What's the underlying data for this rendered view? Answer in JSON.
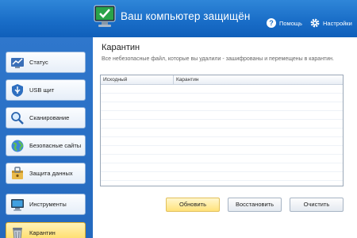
{
  "header": {
    "title": "Ваш компьютер защищён",
    "help_label": "Помощь",
    "settings_label": "Настройки",
    "logo_icon": "monitor-check-icon"
  },
  "sidebar": {
    "items": [
      {
        "label": "Статус",
        "icon": "status-icon",
        "active": false
      },
      {
        "label": "USB щит",
        "icon": "usb-shield-icon",
        "active": false
      },
      {
        "label": "Сканирование",
        "icon": "scan-magnifier-icon",
        "active": false
      },
      {
        "label": "Безопасные сайты",
        "icon": "globe-icon",
        "active": false
      },
      {
        "label": "Защита данных",
        "icon": "data-protection-icon",
        "active": false
      },
      {
        "label": "Инструменты",
        "icon": "tools-monitor-icon",
        "active": false
      },
      {
        "label": "Карантин",
        "icon": "trash-bin-icon",
        "active": true
      }
    ]
  },
  "main": {
    "title": "Карантин",
    "description": "Все небезопасные файл, которые вы удалили - зашифрованы и перемещены в карантин.",
    "table": {
      "columns": [
        "Исходный",
        "Карантин"
      ],
      "rows": []
    },
    "buttons": {
      "refresh": "Обновить",
      "restore": "Восстановить",
      "clear": "Очистить"
    }
  },
  "colors": {
    "header_blue": "#1a6ec8",
    "sidebar_blue": "#2a70c5",
    "active_yellow": "#ffd95c"
  }
}
